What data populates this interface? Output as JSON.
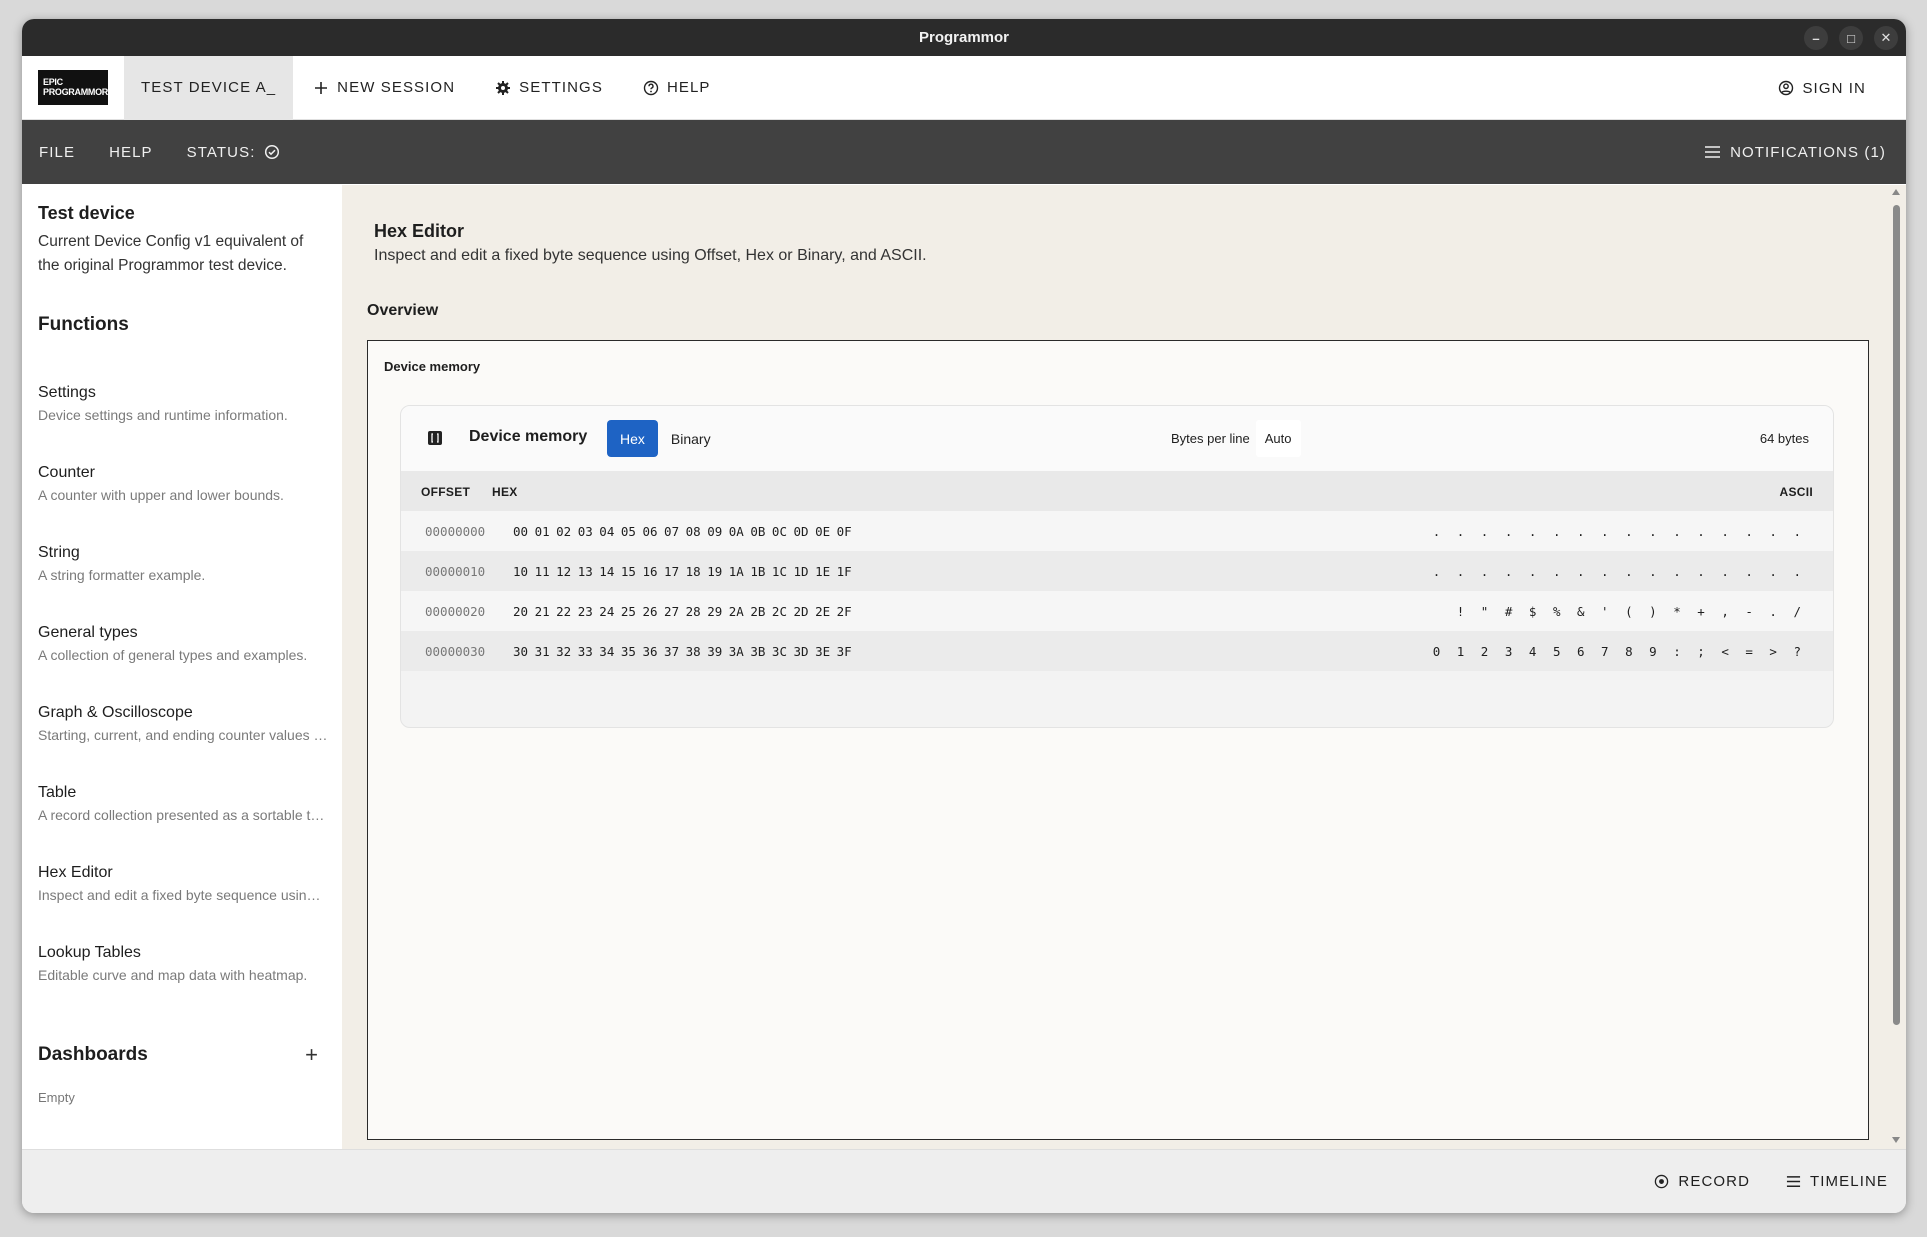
{
  "window": {
    "title": "Programmor"
  },
  "header": {
    "logo_line1": "EPIC",
    "logo_line2": "PROGRAMMOR",
    "active_tab": "TEST DEVICE A_",
    "new_session": "NEW SESSION",
    "settings": "SETTINGS",
    "help": "HELP",
    "sign_in": "SIGN IN"
  },
  "toolbar": {
    "file": "FILE",
    "help": "HELP",
    "status": "STATUS:",
    "notifications": "NOTIFICATIONS (1)"
  },
  "sidebar": {
    "device_title": "Test device",
    "device_desc": "Current Device Config v1 equivalent of the original Programmor test device.",
    "functions_heading": "Functions",
    "items": [
      {
        "title": "Settings",
        "desc": "Device settings and runtime information."
      },
      {
        "title": "Counter",
        "desc": "A counter with upper and lower bounds."
      },
      {
        "title": "String",
        "desc": "A string formatter example."
      },
      {
        "title": "General types",
        "desc": "A collection of general types and examples."
      },
      {
        "title": "Graph & Oscilloscope",
        "desc": "Starting, current, and ending counter values plotted."
      },
      {
        "title": "Table",
        "desc": "A record collection presented as a sortable table."
      },
      {
        "title": "Hex Editor",
        "desc": "Inspect and edit a fixed byte sequence using Offset."
      },
      {
        "title": "Lookup Tables",
        "desc": "Editable curve and map data with heatmap."
      }
    ],
    "dashboards_heading": "Dashboards",
    "dashboards_empty": "Empty"
  },
  "main": {
    "title": "Hex Editor",
    "desc": "Inspect and edit a fixed byte sequence using Offset, Hex or Binary, and ASCII.",
    "overview": "Overview",
    "panel_label": "Device memory",
    "card": {
      "title": "Device memory",
      "mode_hex": "Hex",
      "mode_binary": "Binary",
      "bytes_per_line_label": "Bytes per line",
      "bytes_per_line_value": "Auto",
      "size": "64 bytes",
      "col_offset": "OFFSET",
      "col_hex": "HEX",
      "col_ascii": "ASCII",
      "rows": [
        {
          "offset": "00000000",
          "hex": "00 01 02 03 04 05 06 07 08 09 0A 0B 0C 0D 0E 0F",
          "ascii": ". . . . . . . . . . . . . . . ."
        },
        {
          "offset": "00000010",
          "hex": "10 11 12 13 14 15 16 17 18 19 1A 1B 1C 1D 1E 1F",
          "ascii": ". . . . . . . . . . . . . . . ."
        },
        {
          "offset": "00000020",
          "hex": "20 21 22 23 24 25 26 27 28 29 2A 2B 2C 2D 2E 2F",
          "ascii": "  ! \" # $ % & ' ( ) * + , - . /"
        },
        {
          "offset": "00000030",
          "hex": "30 31 32 33 34 35 36 37 38 39 3A 3B 3C 3D 3E 3F",
          "ascii": "0 1 2 3 4 5 6 7 8 9 : ; < = > ?"
        }
      ]
    }
  },
  "footer": {
    "record": "RECORD",
    "timeline": "TIMELINE"
  },
  "colors": {
    "accent": "#1e63c4",
    "toolbar": "#414141",
    "titlebar": "#2b2b2b",
    "main_bg": "#f2eee7"
  }
}
